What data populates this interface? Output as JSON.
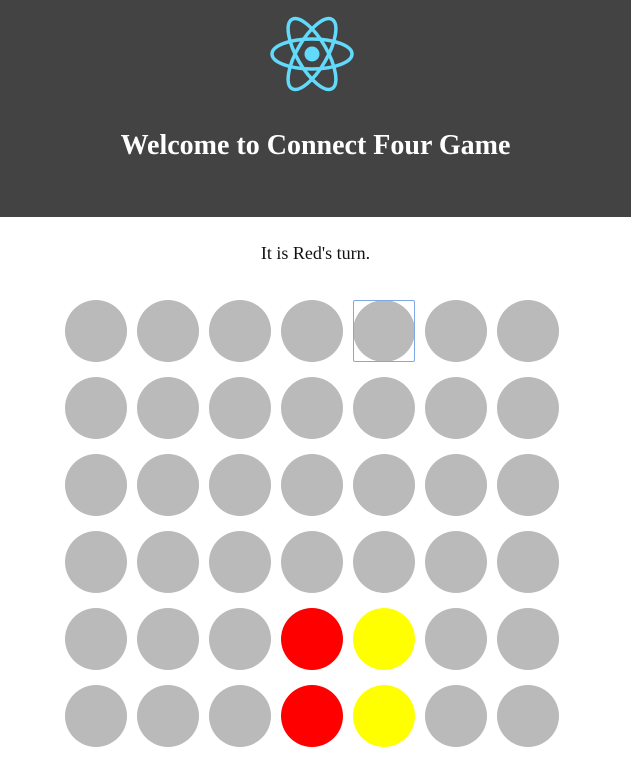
{
  "header": {
    "title": "Welcome to Connect Four Game",
    "logo_icon": "react-atom-icon",
    "background": "#434343",
    "logo_color": "#61dafb"
  },
  "status": {
    "text": "It is Red's turn."
  },
  "board": {
    "rows": 6,
    "columns": 7,
    "focused_cell": {
      "row": 0,
      "col": 4
    },
    "cells": [
      [
        "empty",
        "empty",
        "empty",
        "empty",
        "empty",
        "empty",
        "empty"
      ],
      [
        "empty",
        "empty",
        "empty",
        "empty",
        "empty",
        "empty",
        "empty"
      ],
      [
        "empty",
        "empty",
        "empty",
        "empty",
        "empty",
        "empty",
        "empty"
      ],
      [
        "empty",
        "empty",
        "empty",
        "empty",
        "empty",
        "empty",
        "empty"
      ],
      [
        "empty",
        "empty",
        "empty",
        "red",
        "yellow",
        "empty",
        "empty"
      ],
      [
        "empty",
        "empty",
        "empty",
        "red",
        "yellow",
        "empty",
        "empty"
      ]
    ],
    "colors": {
      "empty": "#bababa",
      "red": "#ff0000",
      "yellow": "#ffff00"
    }
  }
}
